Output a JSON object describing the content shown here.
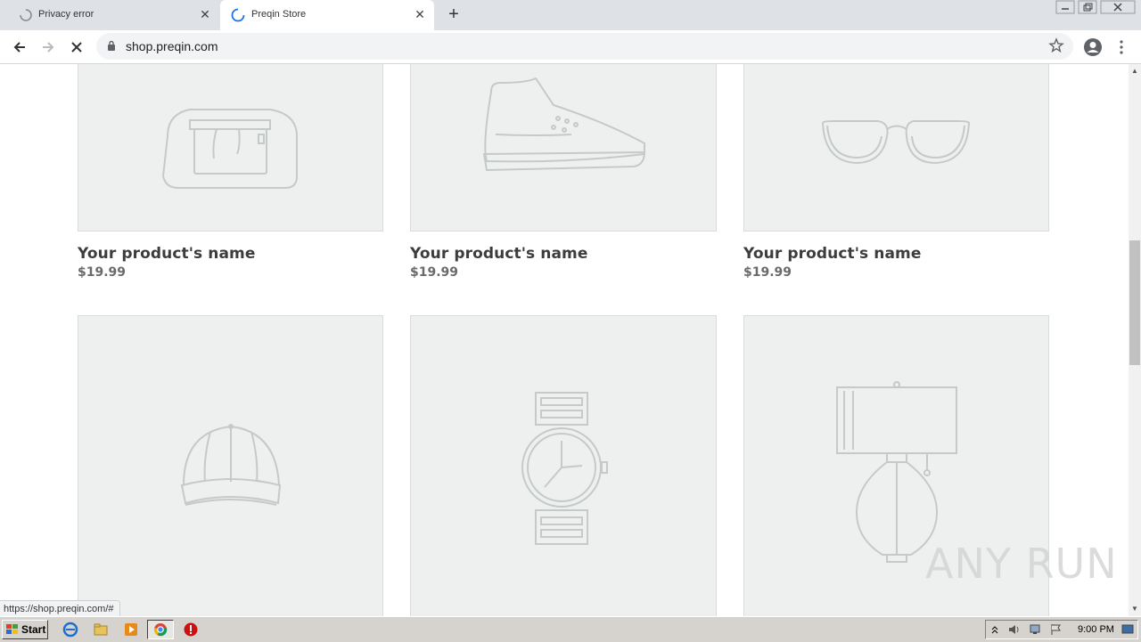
{
  "browser": {
    "tabs": [
      {
        "title": "Privacy error",
        "active": false
      },
      {
        "title": "Preqin Store",
        "active": true
      }
    ],
    "new_tab_label": "+",
    "address": "shop.preqin.com",
    "status_url": "https://shop.preqin.com/#"
  },
  "products_row1": [
    {
      "name": "Your product's name",
      "price": "$19.99",
      "icon": "backpack-icon"
    },
    {
      "name": "Your product's name",
      "price": "$19.99",
      "icon": "sneaker-icon"
    },
    {
      "name": "Your product's name",
      "price": "$19.99",
      "icon": "glasses-icon"
    }
  ],
  "products_row2": [
    {
      "icon": "cap-icon"
    },
    {
      "icon": "watch-icon"
    },
    {
      "icon": "lamp-icon"
    }
  ],
  "watermark": "ANY RUN",
  "taskbar": {
    "start_label": "Start",
    "clock": "9:00 PM"
  },
  "colors": {
    "tabstrip": "#dee1e6",
    "card_bg": "#eef0f0",
    "icon_stroke": "#c6c9c9",
    "product_name": "#3c3c3c",
    "price": "#6a6a6a",
    "taskbar": "#d6d3ce"
  }
}
